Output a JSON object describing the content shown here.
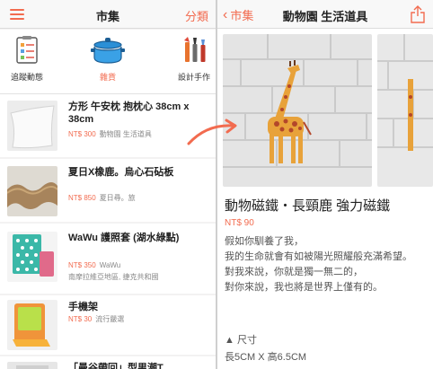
{
  "left": {
    "title": "市集",
    "right_link": "分類",
    "categories": [
      {
        "label": "追蹤動態",
        "icon": "checklist-icon",
        "active": false
      },
      {
        "label": "雜貨",
        "icon": "pot-icon",
        "active": true
      },
      {
        "label": "設計手作",
        "icon": "brushes-icon",
        "active": false
      }
    ],
    "items": [
      {
        "title": "方形 午安枕 抱枕心 38cm x 38cm",
        "price": "NT$ 300",
        "store": "動物園 生活道具",
        "sub": ""
      },
      {
        "title": "夏日X橡鹿。烏心石砧板",
        "price": "NT$ 850",
        "store": "夏日尋。旅",
        "sub": ""
      },
      {
        "title": "WaWu 護照套 (湖水綠點)",
        "price": "NT$ 350",
        "store": "WaWu",
        "sub": "南摩拉維亞地區, 捷克共和國"
      },
      {
        "title": "手機架",
        "price": "NT$ 30",
        "store": "流行嚴選",
        "sub": ""
      },
      {
        "title": "「曼谷帶回」型男潮T",
        "price": "",
        "store": "",
        "sub": ""
      }
    ]
  },
  "right": {
    "back_label": "市集",
    "title": "動物園 生活道具",
    "share_icon": "share-icon",
    "product_title": "動物磁鐵・長頸鹿 強力磁鐵",
    "price": "NT$ 90",
    "description": [
      "假如你馴養了我，",
      "我的生命就會有如被陽光照耀般充滿希望。",
      "對我來說，你就是獨一無二的，",
      "對你來說，我也將是世界上僅有的。"
    ],
    "spec_title": "▲ 尺寸",
    "spec_value": "長5CM X 高6.5CM"
  },
  "colors": {
    "accent": "#f26b4f",
    "price": "#f26b4f",
    "muted": "#888888"
  }
}
